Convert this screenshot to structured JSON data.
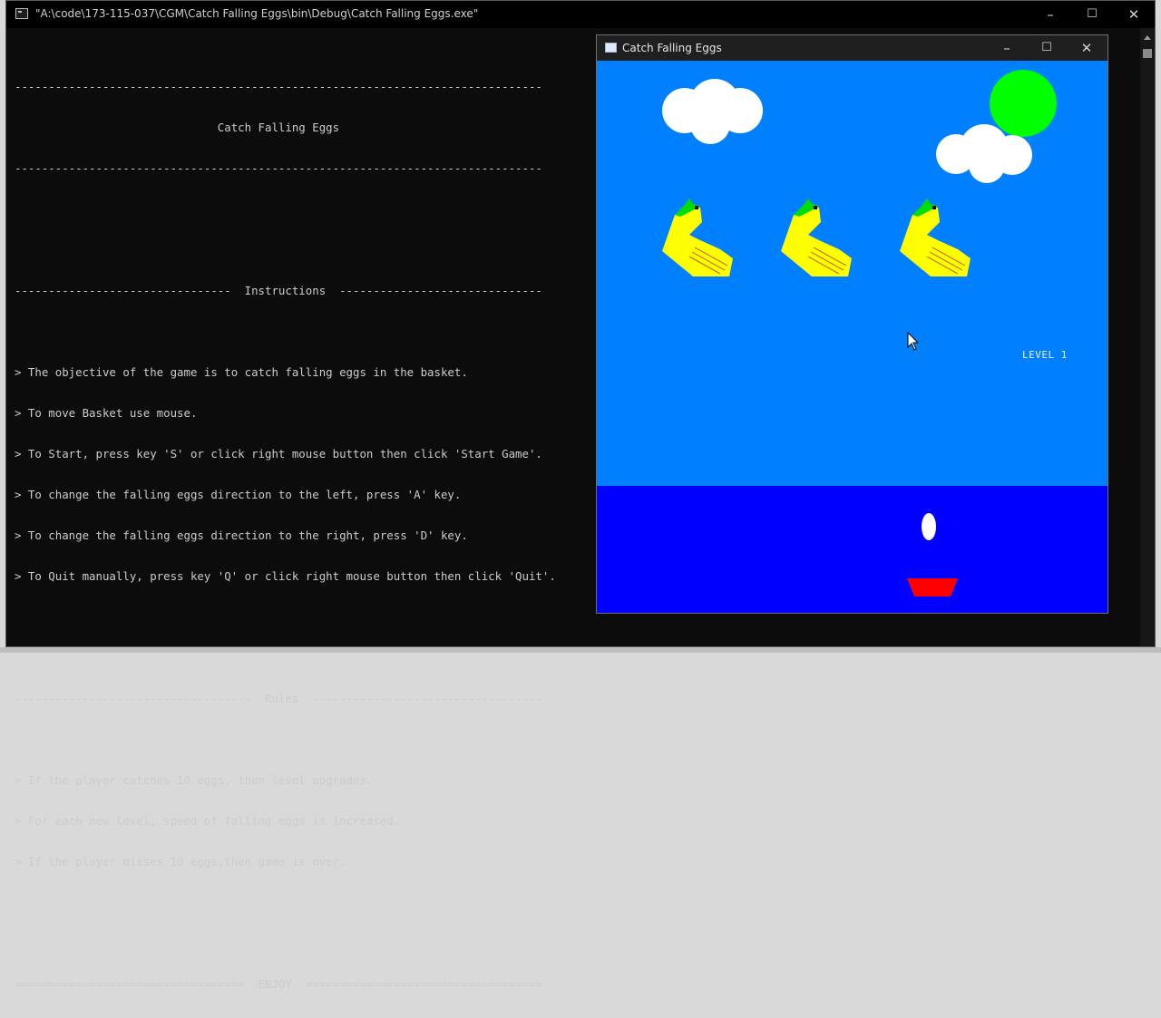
{
  "console": {
    "title": "\"A:\\code\\173-115-037\\CGM\\Catch Falling Eggs\\bin\\Debug\\Catch Falling Eggs.exe\"",
    "lines": [
      "------------------------------------------------------------------------------",
      "                              Catch Falling Eggs",
      "------------------------------------------------------------------------------",
      "",
      "",
      "--------------------------------  Instructions  ------------------------------",
      "",
      "> The objective of the game is to catch falling eggs in the basket.",
      "> To move Basket use mouse.",
      "> To Start, press key 'S' or click right mouse button then click 'Start Game'.",
      "> To change the falling eggs direction to the left, press 'A' key.",
      "> To change the falling eggs direction to the right, press 'D' key.",
      "> To Quit manually, press key 'Q' or click right mouse button then click 'Quit'.",
      "",
      "",
      "-----------------------------------  Rules  ----------------------------------",
      "",
      "> If the player catches 10 eggs, then level upgrades.",
      "> For each new level, speed of falling eggs is increased.",
      "> If the player misses 10 eggs,then game is over.",
      "",
      "",
      "==================================  ENJOY  ==================================="
    ]
  },
  "game": {
    "title": "Catch Falling Eggs",
    "level_label": "LEVEL 1",
    "colors": {
      "sky": "#0080ff",
      "water": "#0000ff",
      "sun": "#00ff00",
      "cloud": "#ffffff",
      "duck_body": "#ffff00",
      "duck_head_tuft": "#00dd00",
      "duck_wing_lines": "#cc4400",
      "basket": "#ff0000",
      "egg": "#ffffff"
    }
  },
  "window_controls": {
    "minimize": "–",
    "maximize": "☐",
    "close": "✕"
  }
}
